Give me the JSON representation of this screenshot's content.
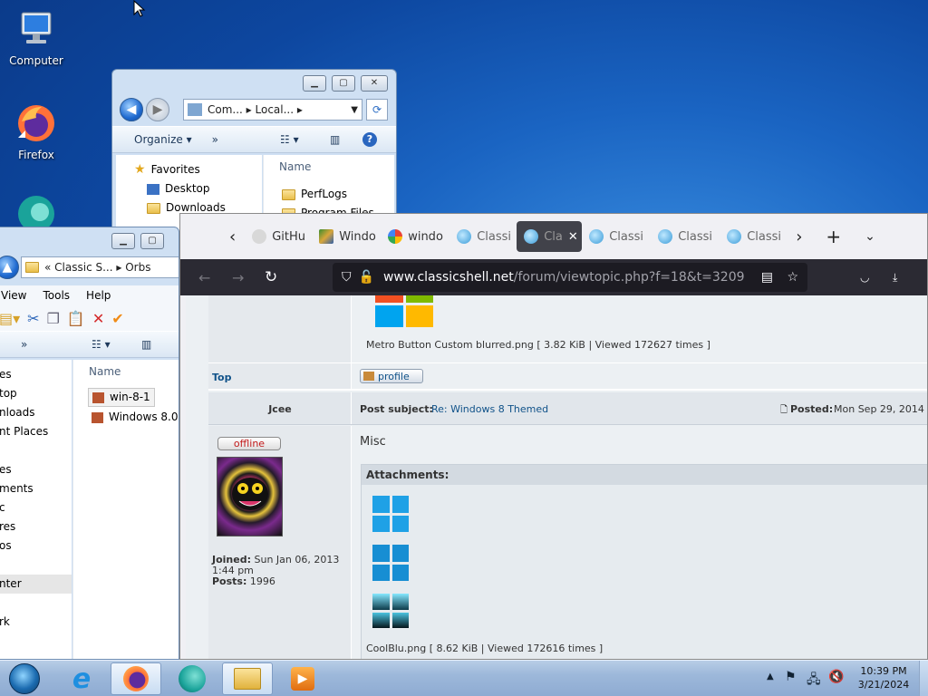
{
  "desktop": {
    "icons": [
      {
        "label": "Computer",
        "icon": "computer-icon"
      },
      {
        "label": "Firefox",
        "icon": "firefox-icon"
      },
      {
        "label": "",
        "icon": "browser-icon"
      }
    ]
  },
  "explorer_back": {
    "breadcrumb": [
      "Com...",
      "Local..."
    ],
    "toolbar": {
      "organize": "Organize",
      "more": "»"
    },
    "nav": {
      "favorites": "Favorites",
      "items": [
        "Desktop",
        "Downloads"
      ]
    },
    "list": {
      "header": "Name",
      "items": [
        "PerfLogs",
        "Program Files"
      ]
    }
  },
  "explorer_front": {
    "breadcrumb": [
      "«",
      "Classic S...",
      "Orbs"
    ],
    "menu": [
      "View",
      "Tools",
      "Help"
    ],
    "more": "»",
    "nav_items": [
      "es",
      "top",
      "nloads",
      "nt Places",
      "es",
      "ments",
      "c",
      "res",
      "os",
      "nter",
      "rk"
    ],
    "list": {
      "header": "Name",
      "items": [
        "win-8-1",
        "Windows 8.0"
      ]
    }
  },
  "firefox": {
    "tabs": [
      {
        "label": "GitHu",
        "icon": "github-icon"
      },
      {
        "label": "Windo",
        "icon": "winstep-icon"
      },
      {
        "label": "windo",
        "icon": "google-icon"
      },
      {
        "label": "Classi",
        "icon": "classicshell-icon"
      },
      {
        "label": "Cla",
        "icon": "classicshell-icon",
        "active": true
      },
      {
        "label": "Classi",
        "icon": "classicshell-icon"
      },
      {
        "label": "Classi",
        "icon": "classicshell-icon"
      },
      {
        "label": "Classi",
        "icon": "classicshell-icon"
      }
    ],
    "url_host": "www.classicshell.net",
    "url_path": "/forum/viewtopic.php?f=18&t=3209",
    "page": {
      "prev_attachment_caption": "Metro Button Custom blurred.png [ 3.82 KiB | Viewed 172627 times ]",
      "top_link": "Top",
      "profile_label": "profile",
      "author": "Jcee",
      "subject_label": "Post subject:",
      "subject_value": "Re: Windows 8 Themed",
      "posted_label": "Posted:",
      "posted_value": "Mon Sep 29, 2014",
      "status": "offline",
      "body": "Misc",
      "attachments_title": "Attachments:",
      "joined_label": "Joined:",
      "joined_value": "Sun Jan 06, 2013 1:44 pm",
      "posts_label": "Posts:",
      "posts_value": "1996",
      "attachment_caption": "CoolBlu.png [ 8.62 KiB | Viewed 172616 times ]"
    }
  },
  "taskbar": {
    "time": "10:39 PM",
    "date": "3/21/2024"
  }
}
